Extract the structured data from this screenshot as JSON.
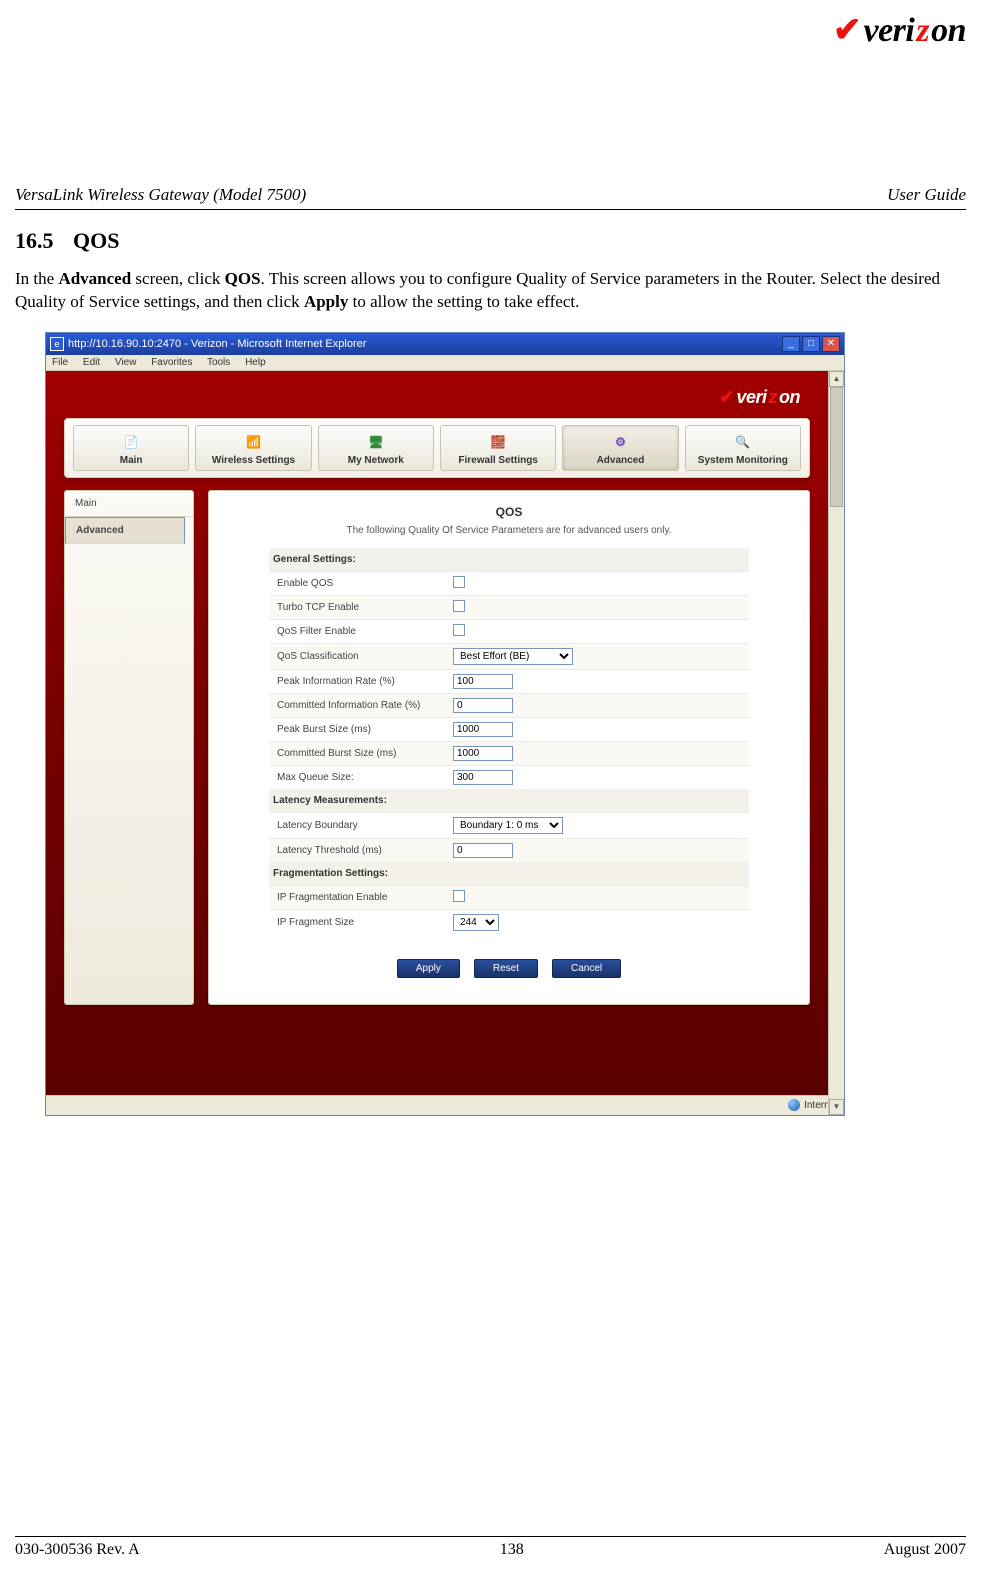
{
  "brand": "verizon",
  "doc_header_left": "VersaLink Wireless Gateway (Model 7500)",
  "doc_header_right": "User Guide",
  "section_number": "16.5",
  "section_title": "QOS",
  "paragraph_parts": {
    "t1": "In the ",
    "b1": "Advanced",
    "t2": " screen, click ",
    "b2": "QOS",
    "t3": ".  This screen allows you to configure Quality of Service parameters in the Router. Select the desired Quality of Service settings, and then click ",
    "b3": "Apply",
    "t4": " to allow the setting to take effect."
  },
  "footer": {
    "left": "030-300536 Rev. A",
    "center": "138",
    "right": "August 2007"
  },
  "screenshot": {
    "window_title": "http://10.16.90.10:2470 - Verizon - Microsoft Internet Explorer",
    "window_icon_glyph": "e",
    "menus": [
      "File",
      "Edit",
      "View",
      "Favorites",
      "Tools",
      "Help"
    ],
    "status_bar_text": "Internet",
    "nav_tabs": [
      {
        "label": "Main",
        "glyph": "📄"
      },
      {
        "label": "Wireless Settings",
        "glyph": "📶"
      },
      {
        "label": "My Network",
        "glyph": "🖥"
      },
      {
        "label": "Firewall Settings",
        "glyph": "🧱"
      },
      {
        "label": "Advanced",
        "glyph": "⚙"
      },
      {
        "label": "System Monitoring",
        "glyph": "🔍"
      }
    ],
    "active_tab_index": 4,
    "side_nav": [
      {
        "label": "Main",
        "selected": false
      },
      {
        "label": "Advanced",
        "selected": true
      }
    ],
    "panel": {
      "title": "QOS",
      "subtitle": "The following Quality Of Service Parameters are for advanced users only.",
      "sections": {
        "general": {
          "title": "General Settings:",
          "enable_qos": "Enable QOS",
          "turbo_tcp": "Turbo TCP Enable",
          "qos_filter": "QoS Filter Enable",
          "qos_class_label": "QoS Classification",
          "qos_class_value": "Best Effort (BE)",
          "peak_info_label": "Peak Information Rate (%)",
          "peak_info_value": "100",
          "committed_info_label": "Committed Information Rate (%)",
          "committed_info_value": "0",
          "peak_burst_label": "Peak Burst Size (ms)",
          "peak_burst_value": "1000",
          "committed_burst_label": "Committed Burst Size (ms)",
          "committed_burst_value": "1000",
          "max_queue_label": "Max Queue Size:",
          "max_queue_value": "300"
        },
        "latency": {
          "title": "Latency Measurements:",
          "boundary_label": "Latency Boundary",
          "boundary_value": "Boundary 1: 0 ms",
          "threshold_label": "Latency Threshold (ms)",
          "threshold_value": "0"
        },
        "frag": {
          "title": "Fragmentation Settings:",
          "ip_frag_enable": "IP Fragmentation Enable",
          "ip_frag_size_label": "IP Fragment Size",
          "ip_frag_size_value": "244"
        }
      },
      "buttons": {
        "apply": "Apply",
        "reset": "Reset",
        "cancel": "Cancel"
      }
    }
  }
}
